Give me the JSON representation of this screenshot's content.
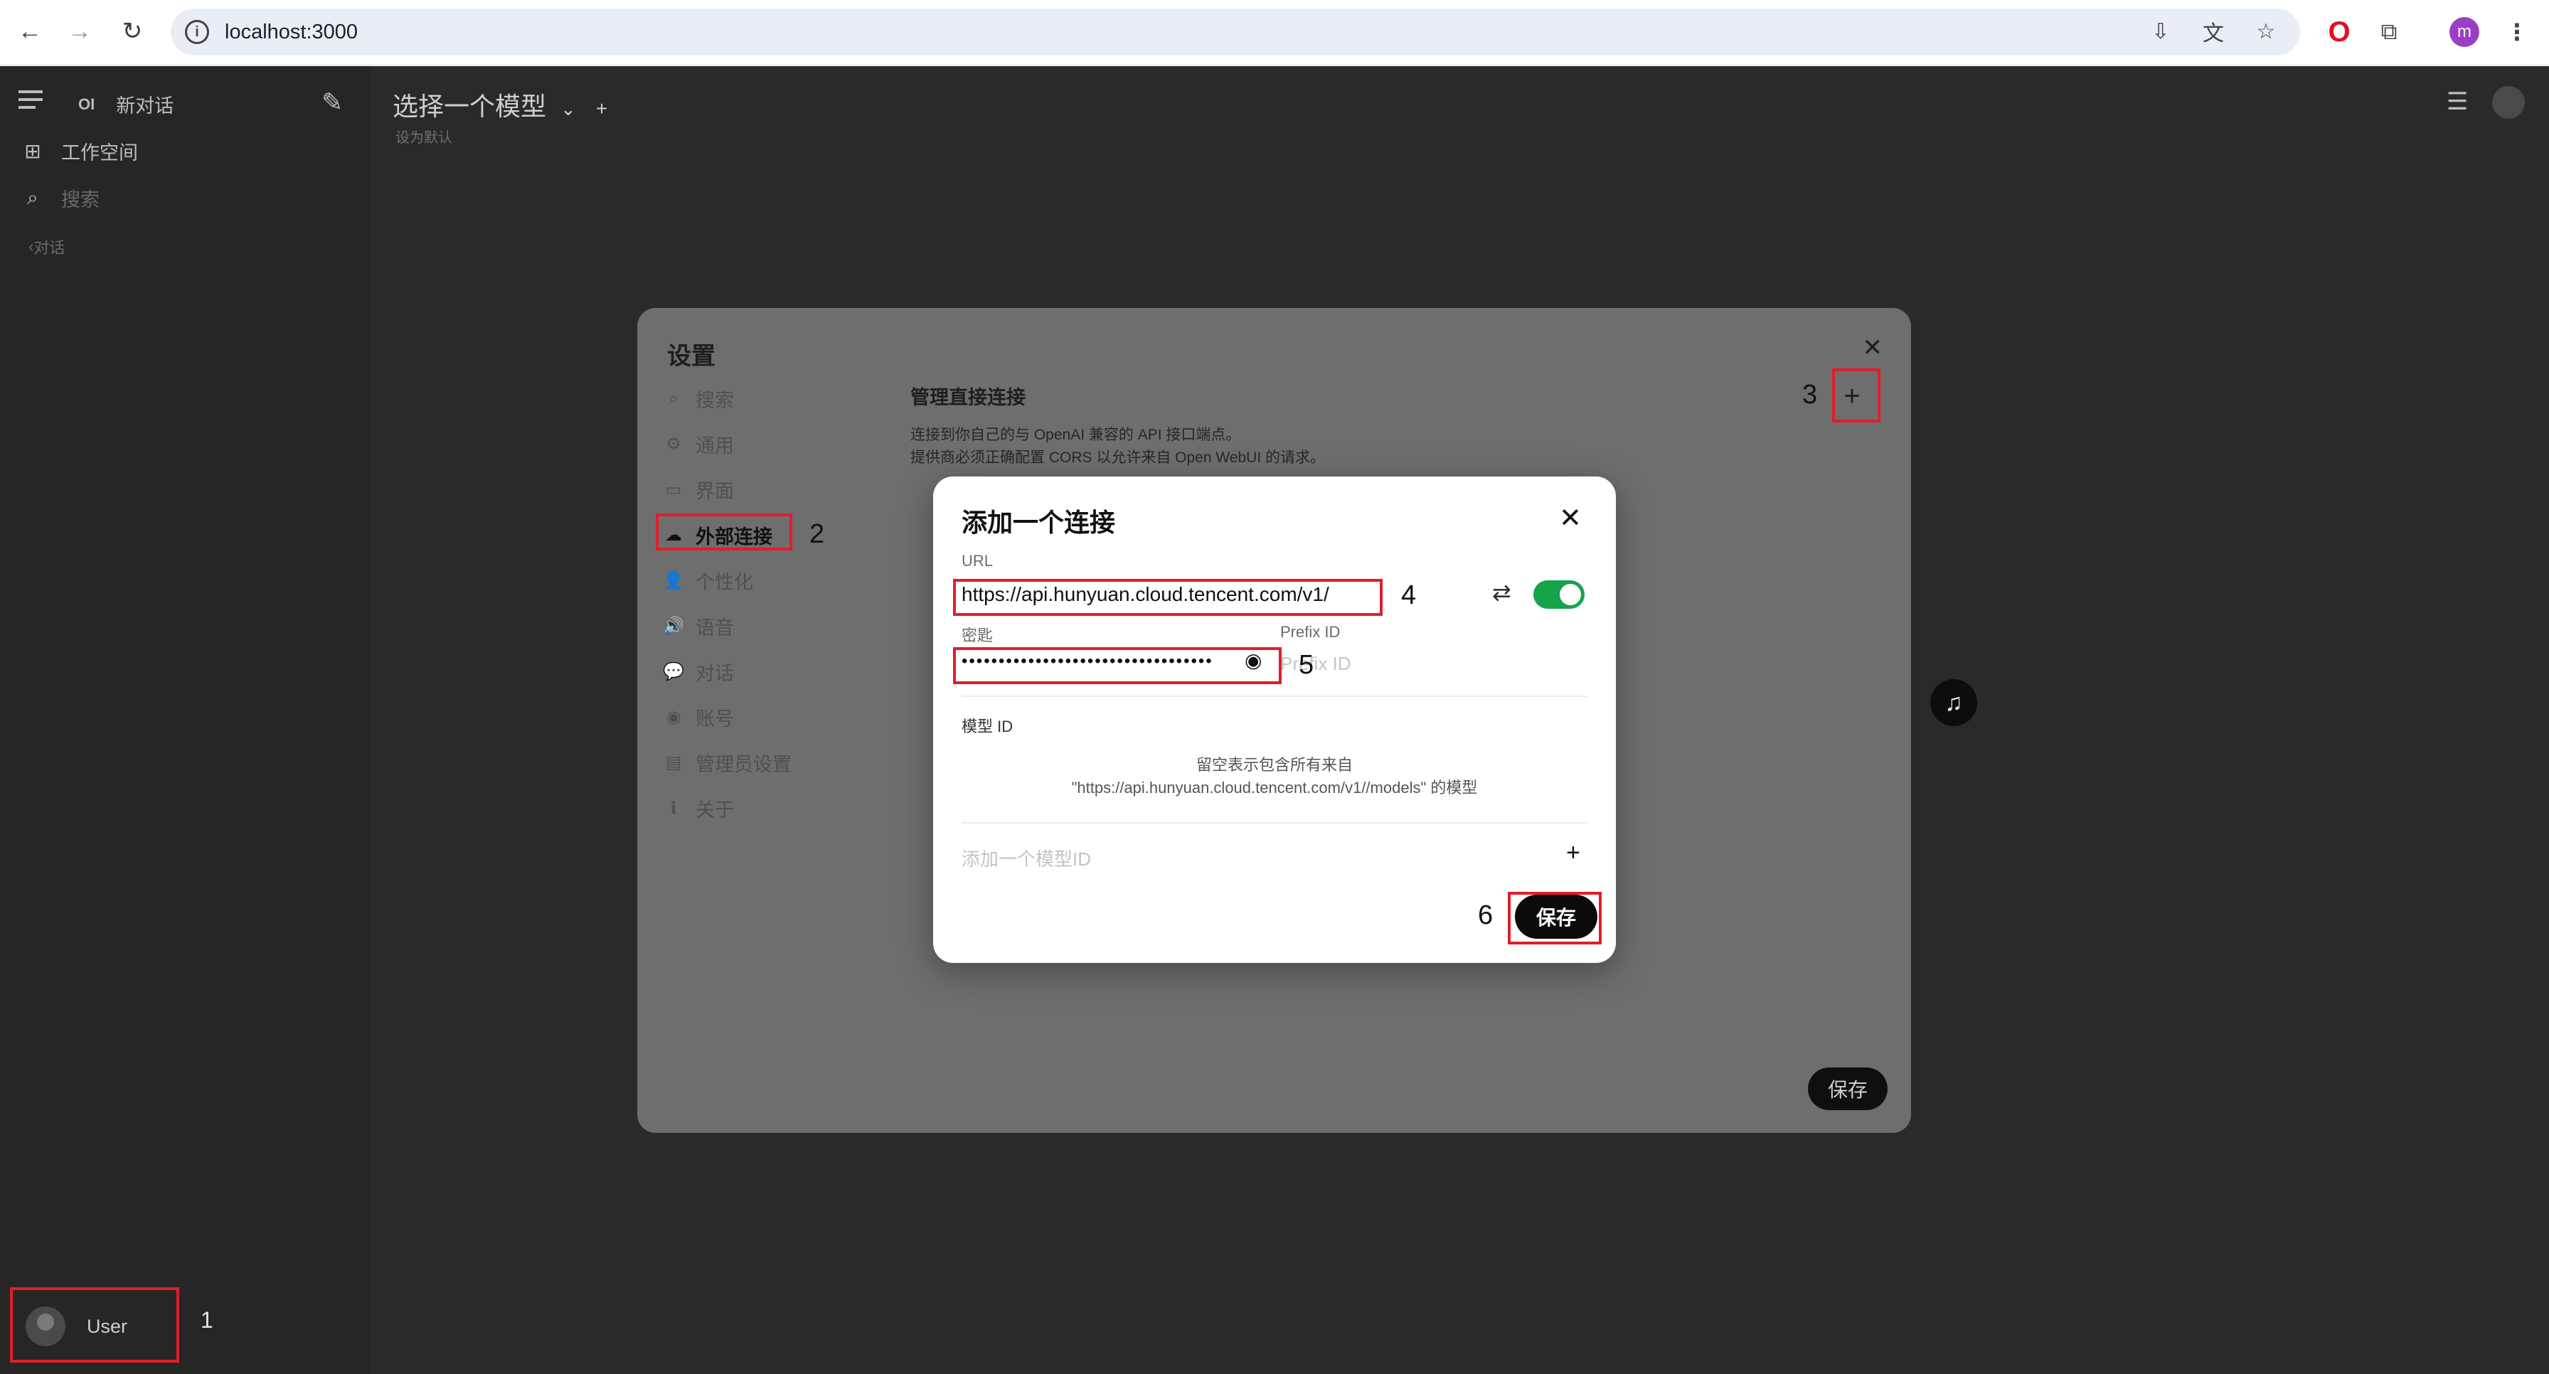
{
  "browser": {
    "url": "localhost:3000",
    "profile_initial": "m",
    "icons": [
      "back-icon",
      "forward-icon",
      "reload-icon",
      "site-info-icon",
      "install-icon",
      "translate-icon",
      "star-icon",
      "opera-icon",
      "extensions-icon",
      "menu-icon"
    ]
  },
  "sidebar": {
    "logo": "OI",
    "new_chat": "新对话",
    "workspace": "工作空间",
    "search": "搜索",
    "section": "对话",
    "user": "User"
  },
  "topbar": {
    "model_select": "选择一个模型",
    "model_chevron": "⌄",
    "add": "+",
    "set_default": "设为默认"
  },
  "settings": {
    "title": "设置",
    "nav": [
      {
        "icon": "search-icon",
        "glyph": "⌕",
        "label": "搜索"
      },
      {
        "icon": "gear-icon",
        "glyph": "⚙",
        "label": "通用"
      },
      {
        "icon": "monitor-icon",
        "glyph": "▭",
        "label": "界面"
      },
      {
        "icon": "cloud-icon",
        "glyph": "☁",
        "label": "外部连接"
      },
      {
        "icon": "person-icon",
        "glyph": "👤",
        "label": "个性化"
      },
      {
        "icon": "speaker-icon",
        "glyph": "🔊",
        "label": "语音"
      },
      {
        "icon": "chat-icon",
        "glyph": "💬",
        "label": "对话"
      },
      {
        "icon": "account-icon",
        "glyph": "◉",
        "label": "账号"
      },
      {
        "icon": "admin-icon",
        "glyph": "▤",
        "label": "管理员设置"
      },
      {
        "icon": "info-icon",
        "glyph": "ℹ",
        "label": "关于"
      }
    ],
    "heading": "管理直接连接",
    "desc_line1": "连接到你自己的与 OpenAI 兼容的 API 接口端点。",
    "desc_line2": "提供商必须正确配置 CORS 以允许来自 Open WebUI 的请求。",
    "save": "保存"
  },
  "dialog": {
    "title": "添加一个连接",
    "url_label": "URL",
    "url_value": "https://api.hunyuan.cloud.tencent.com/v1/",
    "key_label": "密匙",
    "key_value": "••••••••••••••••••••••••••••••••••",
    "prefix_label": "Prefix ID",
    "prefix_placeholder": "Prefix ID",
    "model_id_label": "模型 ID",
    "hint_line1": "留空表示包含所有来自",
    "hint_line2": "\"https://api.hunyuan.cloud.tencent.com/v1//models\" 的模型",
    "add_model_placeholder": "添加一个模型ID",
    "save": "保存",
    "toggle_enabled": true
  },
  "annotations": {
    "colors": {
      "box": "#e11d2a"
    },
    "step1": "1",
    "step2": "2",
    "step3": "3",
    "step4": "4",
    "step5": "5",
    "step6": "6"
  }
}
